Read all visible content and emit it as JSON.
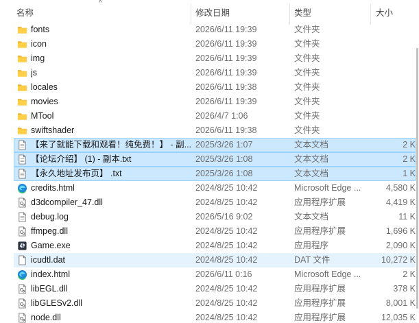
{
  "header": {
    "name": "名称",
    "date": "修改日期",
    "type": "类型",
    "size": "大小",
    "sort_arrow": "^"
  },
  "files": [
    {
      "name": "fonts",
      "date": "2026/6/11 19:39",
      "type": "文件夹",
      "size": "",
      "icon": "folder-icon",
      "state": "normal"
    },
    {
      "name": "icon",
      "date": "2026/6/11 19:39",
      "type": "文件夹",
      "size": "",
      "icon": "folder-icon",
      "state": "normal"
    },
    {
      "name": "img",
      "date": "2026/6/11 19:39",
      "type": "文件夹",
      "size": "",
      "icon": "folder-icon",
      "state": "normal"
    },
    {
      "name": "js",
      "date": "2026/6/11 19:39",
      "type": "文件夹",
      "size": "",
      "icon": "folder-icon",
      "state": "normal"
    },
    {
      "name": "locales",
      "date": "2026/6/11 19:38",
      "type": "文件夹",
      "size": "",
      "icon": "folder-icon",
      "state": "normal"
    },
    {
      "name": "movies",
      "date": "2026/6/11 19:39",
      "type": "文件夹",
      "size": "",
      "icon": "folder-icon",
      "state": "normal"
    },
    {
      "name": "MTool",
      "date": "2026/4/7 1:06",
      "type": "文件夹",
      "size": "",
      "icon": "folder-icon",
      "state": "normal"
    },
    {
      "name": "swiftshader",
      "date": "2026/6/11 19:38",
      "type": "文件夹",
      "size": "",
      "icon": "folder-icon",
      "state": "normal"
    },
    {
      "name": "【来了就能下载和观看！纯免费！】 - 副...",
      "date": "2025/3/26 1:07",
      "type": "文本文档",
      "size": "2 K",
      "icon": "text-file-icon",
      "state": "selected"
    },
    {
      "name": "【论坛介绍】 (1) - 副本.txt",
      "date": "2025/3/26 1:08",
      "type": "文本文档",
      "size": "2 K",
      "icon": "text-file-icon",
      "state": "selected"
    },
    {
      "name": "【永久地址发布页】 .txt",
      "date": "2025/3/26 1:08",
      "type": "文本文档",
      "size": "1 K",
      "icon": "text-file-icon",
      "state": "selected"
    },
    {
      "name": "credits.html",
      "date": "2024/8/25 10:42",
      "type": "Microsoft Edge ...",
      "size": "4,580 K",
      "icon": "edge-icon",
      "state": "normal"
    },
    {
      "name": "d3dcompiler_47.dll",
      "date": "2024/8/25 10:42",
      "type": "应用程序扩展",
      "size": "4,419 K",
      "icon": "dll-file-icon",
      "state": "normal"
    },
    {
      "name": "debug.log",
      "date": "2026/5/16 9:02",
      "type": "文本文档",
      "size": "11 K",
      "icon": "text-file-icon",
      "state": "normal"
    },
    {
      "name": "ffmpeg.dll",
      "date": "2024/8/25 10:42",
      "type": "应用程序扩展",
      "size": "1,696 K",
      "icon": "dll-file-icon",
      "state": "normal"
    },
    {
      "name": "Game.exe",
      "date": "2024/8/25 10:42",
      "type": "应用程序",
      "size": "2,090 K",
      "icon": "app-icon",
      "state": "normal"
    },
    {
      "name": "icudtl.dat",
      "date": "2024/8/25 10:42",
      "type": "DAT 文件",
      "size": "10,272 K",
      "icon": "blank-file-icon",
      "state": "hover"
    },
    {
      "name": "index.html",
      "date": "2026/6/11 0:16",
      "type": "Microsoft Edge ...",
      "size": "2 K",
      "icon": "edge-icon",
      "state": "normal"
    },
    {
      "name": "libEGL.dll",
      "date": "2024/8/25 10:42",
      "type": "应用程序扩展",
      "size": "378 K",
      "icon": "dll-file-icon",
      "state": "normal"
    },
    {
      "name": "libGLESv2.dll",
      "date": "2024/8/25 10:42",
      "type": "应用程序扩展",
      "size": "8,001 K",
      "icon": "dll-file-icon",
      "state": "normal"
    },
    {
      "name": "node.dll",
      "date": "2024/8/25 10:42",
      "type": "应用程序扩展",
      "size": "12,035 K",
      "icon": "dll-file-icon",
      "state": "normal"
    }
  ]
}
